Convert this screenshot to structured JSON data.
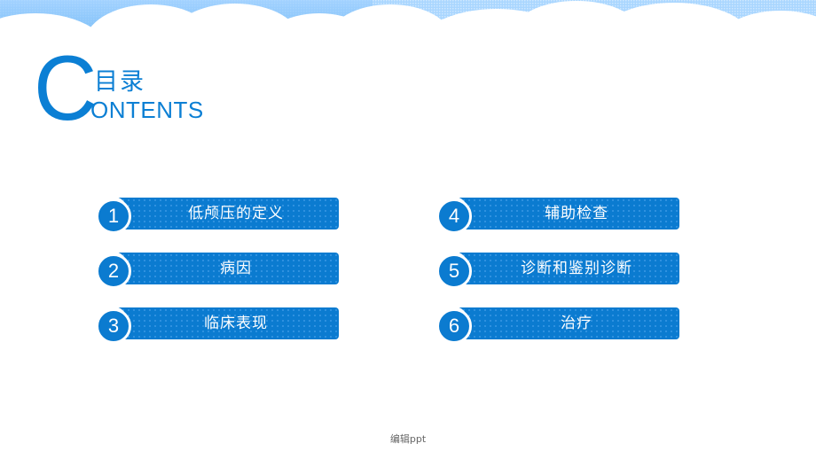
{
  "slide": {
    "title_initial": "C",
    "title_cn": "目录",
    "title_en": "ONTENTS",
    "accent_color": "#0b7bd0",
    "items": [
      {
        "number": "1",
        "label": "低颅压的定义"
      },
      {
        "number": "2",
        "label": "病因"
      },
      {
        "number": "3",
        "label": "临床表现"
      },
      {
        "number": "4",
        "label": "辅助检查"
      },
      {
        "number": "5",
        "label": "诊断和鉴别诊断"
      },
      {
        "number": "6",
        "label": "治疗"
      }
    ],
    "footer": "编辑ppt"
  }
}
